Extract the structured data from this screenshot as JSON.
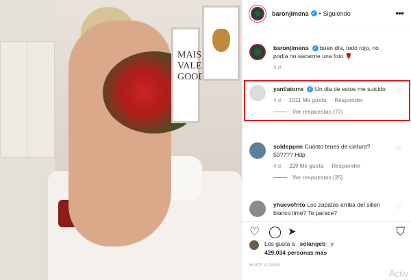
{
  "header": {
    "username": "baronjimena",
    "separator": "•",
    "following_label": "Siguiendo",
    "more_icon": "more-dots-icon"
  },
  "caption": {
    "username": "baronjimena",
    "text": "buen día, todo rojo, no podía no sacarme una foto 🌹",
    "time": "4 d"
  },
  "comments": [
    {
      "username": "yanilatorre",
      "verified": true,
      "text": "Un dia de estos me suicido",
      "time": "4 d",
      "likes": "1011 Me gusta",
      "reply_label": "Responder",
      "view_replies": "Ver respuestas (77)"
    },
    {
      "username": "soldeppen",
      "verified": false,
      "text": "Cuánto tenes de cintura? 50???? Hdp",
      "time": "4 d",
      "likes": "229 Me gusta",
      "reply_label": "Responder",
      "view_replies": "Ver respuestas (25)"
    },
    {
      "username": "yhuevofrito",
      "verified": false,
      "text": "Los zapatos arriba del sillon blanco lime? Te parece?"
    }
  ],
  "likes": {
    "prefix": "Les gusta a",
    "user": "_solangeb_",
    "suffix": "y",
    "count": "429,034 personas más"
  },
  "time_ago": "HACE 4 DÍAS",
  "photo_art_text": "MAIS\nVALE\nGOOD",
  "watermark": "Activ",
  "colors": {
    "highlight": "#e5161e",
    "verified": "#3897f0"
  }
}
